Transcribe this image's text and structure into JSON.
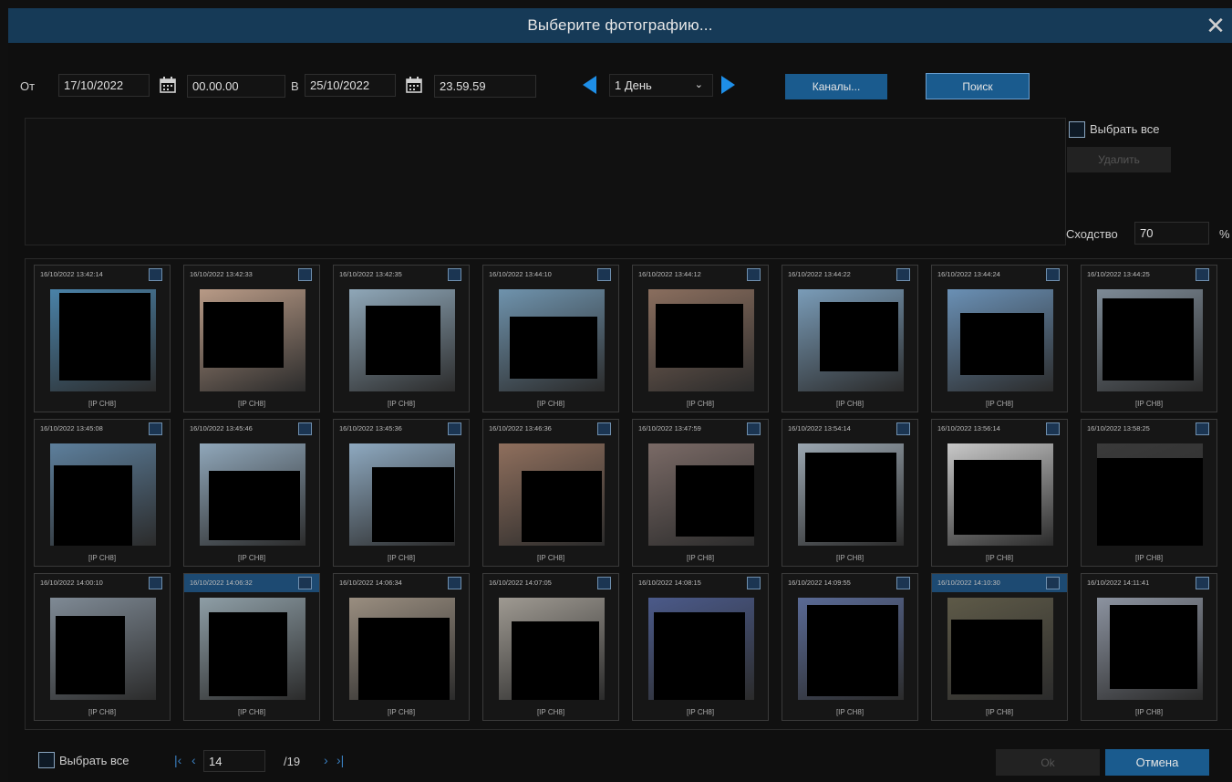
{
  "window": {
    "title": "Выберите фотографию..."
  },
  "filter": {
    "from_label": "От",
    "from_date": "17/10/2022",
    "from_time": "00.00.00",
    "to_label": "В",
    "to_date": "25/10/2022",
    "to_time": "23.59.59",
    "period": "1 День",
    "channels_button": "Каналы...",
    "search_button": "Поиск"
  },
  "side": {
    "select_all": "Выбрать все",
    "delete_button": "Удалить",
    "similarity_label": "Сходство",
    "similarity_value": "70",
    "percent": "%"
  },
  "results": [
    {
      "time": "16/10/2022 13:42:14",
      "channel": "[IP CH8]",
      "selected": false,
      "bg": "#4a82a8"
    },
    {
      "time": "16/10/2022 13:42:33",
      "channel": "[IP CH8]",
      "selected": false,
      "bg": "#b89a86"
    },
    {
      "time": "16/10/2022 13:42:35",
      "channel": "[IP CH8]",
      "selected": false,
      "bg": "#8fa7b8"
    },
    {
      "time": "16/10/2022 13:44:10",
      "channel": "[IP CH8]",
      "selected": false,
      "bg": "#6f93ad"
    },
    {
      "time": "16/10/2022 13:44:12",
      "channel": "[IP CH8]",
      "selected": false,
      "bg": "#8a6e5e"
    },
    {
      "time": "16/10/2022 13:44:22",
      "channel": "[IP CH8]",
      "selected": false,
      "bg": "#7a9cb8"
    },
    {
      "time": "16/10/2022 13:44:24",
      "channel": "[IP CH8]",
      "selected": false,
      "bg": "#6a90b5"
    },
    {
      "time": "16/10/2022 13:44:25",
      "channel": "[IP CH8]",
      "selected": false,
      "bg": "#7d8a96"
    },
    {
      "time": "16/10/2022 13:45:08",
      "channel": "[IP CH8]",
      "selected": false,
      "bg": "#5d7f9c"
    },
    {
      "time": "16/10/2022 13:45:46",
      "channel": "[IP CH8]",
      "selected": false,
      "bg": "#90a7ba"
    },
    {
      "time": "16/10/2022 13:45:36",
      "channel": "[IP CH8]",
      "selected": false,
      "bg": "#8ea9c0"
    },
    {
      "time": "16/10/2022 13:46:36",
      "channel": "[IP CH8]",
      "selected": false,
      "bg": "#8f6f5d"
    },
    {
      "time": "16/10/2022 13:47:59",
      "channel": "[IP CH8]",
      "selected": false,
      "bg": "#7a6a66"
    },
    {
      "time": "16/10/2022 13:54:14",
      "channel": "[IP CH8]",
      "selected": false,
      "bg": "#9aa6b0"
    },
    {
      "time": "16/10/2022 13:56:14",
      "channel": "[IP CH8]",
      "selected": false,
      "bg": "#c8c8c8"
    },
    {
      "time": "16/10/2022 13:58:25",
      "channel": "[IP CH8]",
      "selected": false,
      "bg": "#3a3a3a"
    },
    {
      "time": "16/10/2022 14:00:10",
      "channel": "[IP CH8]",
      "selected": false,
      "bg": "#7f8a95"
    },
    {
      "time": "16/10/2022 14:06:32",
      "channel": "[IP CH8]",
      "selected": true,
      "bg": "#8e9ea6"
    },
    {
      "time": "16/10/2022 14:06:34",
      "channel": "[IP CH8]",
      "selected": false,
      "bg": "#9a8e80"
    },
    {
      "time": "16/10/2022 14:07:05",
      "channel": "[IP CH8]",
      "selected": false,
      "bg": "#9f9a92"
    },
    {
      "time": "16/10/2022 14:08:15",
      "channel": "[IP CH8]",
      "selected": false,
      "bg": "#4b5a8a"
    },
    {
      "time": "16/10/2022 14:09:55",
      "channel": "[IP CH8]",
      "selected": false,
      "bg": "#5a6a95"
    },
    {
      "time": "16/10/2022 14:10:30",
      "channel": "[IP CH8]",
      "selected": true,
      "bg": "#5e5a48"
    },
    {
      "time": "16/10/2022 14:11:41",
      "channel": "[IP CH8]",
      "selected": false,
      "bg": "#8c93a0"
    }
  ],
  "footer": {
    "select_all": "Выбрать все",
    "page_current": "14",
    "page_total": "/19",
    "ok_button": "Ok",
    "cancel_button": "Отмена"
  },
  "colors": {
    "accent": "#1a5b8e",
    "title_bar": "#163a57",
    "arrow": "#1e8fe8"
  }
}
